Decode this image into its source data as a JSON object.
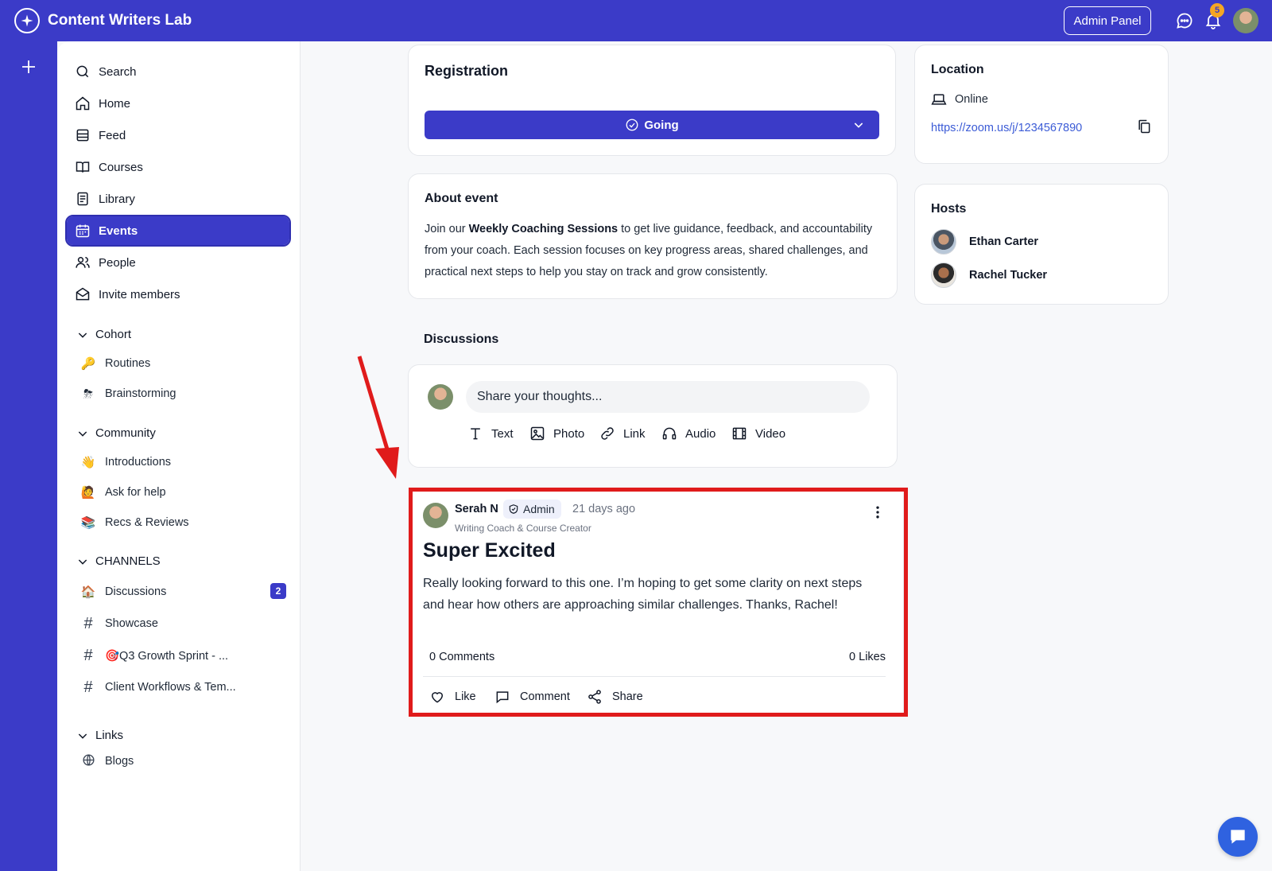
{
  "app": {
    "name": "Content Writers Lab"
  },
  "topbar": {
    "admin_label": "Admin Panel",
    "notification_count": "5"
  },
  "sidebar": {
    "nav": [
      {
        "label": "Search",
        "icon": "search-icon"
      },
      {
        "label": "Home",
        "icon": "home-icon"
      },
      {
        "label": "Feed",
        "icon": "feed-icon"
      },
      {
        "label": "Courses",
        "icon": "book-icon"
      },
      {
        "label": "Library",
        "icon": "library-icon"
      },
      {
        "label": "Events",
        "icon": "calendar-icon",
        "active": true
      },
      {
        "label": "People",
        "icon": "people-icon"
      },
      {
        "label": "Invite members",
        "icon": "envelope-icon"
      }
    ],
    "sections": {
      "cohort": {
        "title": "Cohort",
        "items": [
          {
            "label": "Routines",
            "emoji": "🔑"
          },
          {
            "label": "Brainstorming",
            "emoji": "⛈"
          }
        ]
      },
      "community": {
        "title": "Community",
        "items": [
          {
            "label": "Introductions",
            "emoji": "👋"
          },
          {
            "label": "Ask for help",
            "emoji": "🙋"
          },
          {
            "label": "Recs & Reviews",
            "emoji": "📚"
          }
        ]
      },
      "channels": {
        "title": "CHANNELS",
        "items": [
          {
            "label": "Discussions",
            "emoji": "🏠",
            "badge": "2"
          },
          {
            "label": "Showcase"
          },
          {
            "label": "🎯Q3 Growth Sprint - ..."
          },
          {
            "label": "Client Workflows & Tem..."
          }
        ]
      },
      "links": {
        "title": "Links",
        "items": [
          {
            "label": "Blogs",
            "icon": "globe-icon"
          }
        ]
      }
    }
  },
  "registration": {
    "title": "Registration",
    "status_label": "Going"
  },
  "about": {
    "title": "About event",
    "intro": "Join our ",
    "highlight": "Weekly Coaching Sessions",
    "rest": " to get live guidance, feedback, and accountability from your coach. Each session focuses on key progress areas, shared challenges, and practical next steps to help you stay on track and grow consistently."
  },
  "location": {
    "title": "Location",
    "type": "Online",
    "url": "https://zoom.us/j/1234567890"
  },
  "hosts": {
    "title": "Hosts",
    "items": [
      {
        "name": "Ethan Carter"
      },
      {
        "name": "Rachel Tucker"
      }
    ]
  },
  "discussions": {
    "title": "Discussions",
    "composer": {
      "placeholder": "Share your thoughts...",
      "tools": [
        "Text",
        "Photo",
        "Link",
        "Audio",
        "Video"
      ]
    },
    "post": {
      "author": "Serah N",
      "badge": "Admin",
      "time": "21 days ago",
      "role": "Writing Coach & Course Creator",
      "title": "Super Excited",
      "body": "Really looking forward to this one. I’m hoping to get some clarity on next steps and hear how others are approaching similar challenges. Thanks, Rachel!",
      "comments": "0 Comments",
      "likes": "0 Likes",
      "actions": [
        "Like",
        "Comment",
        "Share"
      ]
    }
  },
  "colors": {
    "brand": "#3b3bc8",
    "highlight": "#e01b1b",
    "link": "#3b5bd6"
  }
}
